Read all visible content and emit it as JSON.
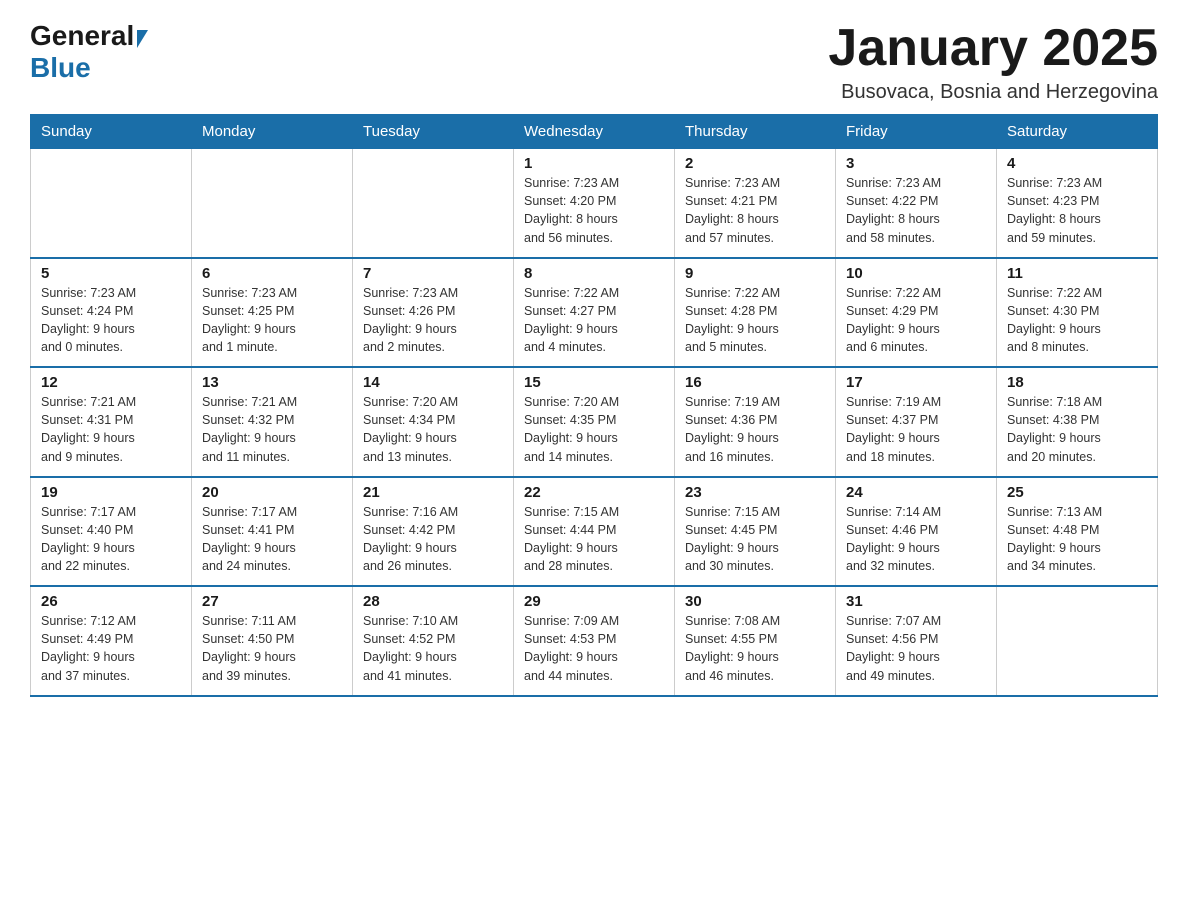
{
  "header": {
    "logo": {
      "general": "General",
      "blue": "Blue"
    },
    "title": "January 2025",
    "location": "Busovaca, Bosnia and Herzegovina"
  },
  "calendar": {
    "days_of_week": [
      "Sunday",
      "Monday",
      "Tuesday",
      "Wednesday",
      "Thursday",
      "Friday",
      "Saturday"
    ],
    "weeks": [
      {
        "days": [
          {
            "date": "",
            "info": ""
          },
          {
            "date": "",
            "info": ""
          },
          {
            "date": "",
            "info": ""
          },
          {
            "date": "1",
            "info": "Sunrise: 7:23 AM\nSunset: 4:20 PM\nDaylight: 8 hours\nand 56 minutes."
          },
          {
            "date": "2",
            "info": "Sunrise: 7:23 AM\nSunset: 4:21 PM\nDaylight: 8 hours\nand 57 minutes."
          },
          {
            "date": "3",
            "info": "Sunrise: 7:23 AM\nSunset: 4:22 PM\nDaylight: 8 hours\nand 58 minutes."
          },
          {
            "date": "4",
            "info": "Sunrise: 7:23 AM\nSunset: 4:23 PM\nDaylight: 8 hours\nand 59 minutes."
          }
        ]
      },
      {
        "days": [
          {
            "date": "5",
            "info": "Sunrise: 7:23 AM\nSunset: 4:24 PM\nDaylight: 9 hours\nand 0 minutes."
          },
          {
            "date": "6",
            "info": "Sunrise: 7:23 AM\nSunset: 4:25 PM\nDaylight: 9 hours\nand 1 minute."
          },
          {
            "date": "7",
            "info": "Sunrise: 7:23 AM\nSunset: 4:26 PM\nDaylight: 9 hours\nand 2 minutes."
          },
          {
            "date": "8",
            "info": "Sunrise: 7:22 AM\nSunset: 4:27 PM\nDaylight: 9 hours\nand 4 minutes."
          },
          {
            "date": "9",
            "info": "Sunrise: 7:22 AM\nSunset: 4:28 PM\nDaylight: 9 hours\nand 5 minutes."
          },
          {
            "date": "10",
            "info": "Sunrise: 7:22 AM\nSunset: 4:29 PM\nDaylight: 9 hours\nand 6 minutes."
          },
          {
            "date": "11",
            "info": "Sunrise: 7:22 AM\nSunset: 4:30 PM\nDaylight: 9 hours\nand 8 minutes."
          }
        ]
      },
      {
        "days": [
          {
            "date": "12",
            "info": "Sunrise: 7:21 AM\nSunset: 4:31 PM\nDaylight: 9 hours\nand 9 minutes."
          },
          {
            "date": "13",
            "info": "Sunrise: 7:21 AM\nSunset: 4:32 PM\nDaylight: 9 hours\nand 11 minutes."
          },
          {
            "date": "14",
            "info": "Sunrise: 7:20 AM\nSunset: 4:34 PM\nDaylight: 9 hours\nand 13 minutes."
          },
          {
            "date": "15",
            "info": "Sunrise: 7:20 AM\nSunset: 4:35 PM\nDaylight: 9 hours\nand 14 minutes."
          },
          {
            "date": "16",
            "info": "Sunrise: 7:19 AM\nSunset: 4:36 PM\nDaylight: 9 hours\nand 16 minutes."
          },
          {
            "date": "17",
            "info": "Sunrise: 7:19 AM\nSunset: 4:37 PM\nDaylight: 9 hours\nand 18 minutes."
          },
          {
            "date": "18",
            "info": "Sunrise: 7:18 AM\nSunset: 4:38 PM\nDaylight: 9 hours\nand 20 minutes."
          }
        ]
      },
      {
        "days": [
          {
            "date": "19",
            "info": "Sunrise: 7:17 AM\nSunset: 4:40 PM\nDaylight: 9 hours\nand 22 minutes."
          },
          {
            "date": "20",
            "info": "Sunrise: 7:17 AM\nSunset: 4:41 PM\nDaylight: 9 hours\nand 24 minutes."
          },
          {
            "date": "21",
            "info": "Sunrise: 7:16 AM\nSunset: 4:42 PM\nDaylight: 9 hours\nand 26 minutes."
          },
          {
            "date": "22",
            "info": "Sunrise: 7:15 AM\nSunset: 4:44 PM\nDaylight: 9 hours\nand 28 minutes."
          },
          {
            "date": "23",
            "info": "Sunrise: 7:15 AM\nSunset: 4:45 PM\nDaylight: 9 hours\nand 30 minutes."
          },
          {
            "date": "24",
            "info": "Sunrise: 7:14 AM\nSunset: 4:46 PM\nDaylight: 9 hours\nand 32 minutes."
          },
          {
            "date": "25",
            "info": "Sunrise: 7:13 AM\nSunset: 4:48 PM\nDaylight: 9 hours\nand 34 minutes."
          }
        ]
      },
      {
        "days": [
          {
            "date": "26",
            "info": "Sunrise: 7:12 AM\nSunset: 4:49 PM\nDaylight: 9 hours\nand 37 minutes."
          },
          {
            "date": "27",
            "info": "Sunrise: 7:11 AM\nSunset: 4:50 PM\nDaylight: 9 hours\nand 39 minutes."
          },
          {
            "date": "28",
            "info": "Sunrise: 7:10 AM\nSunset: 4:52 PM\nDaylight: 9 hours\nand 41 minutes."
          },
          {
            "date": "29",
            "info": "Sunrise: 7:09 AM\nSunset: 4:53 PM\nDaylight: 9 hours\nand 44 minutes."
          },
          {
            "date": "30",
            "info": "Sunrise: 7:08 AM\nSunset: 4:55 PM\nDaylight: 9 hours\nand 46 minutes."
          },
          {
            "date": "31",
            "info": "Sunrise: 7:07 AM\nSunset: 4:56 PM\nDaylight: 9 hours\nand 49 minutes."
          },
          {
            "date": "",
            "info": ""
          }
        ]
      }
    ]
  }
}
